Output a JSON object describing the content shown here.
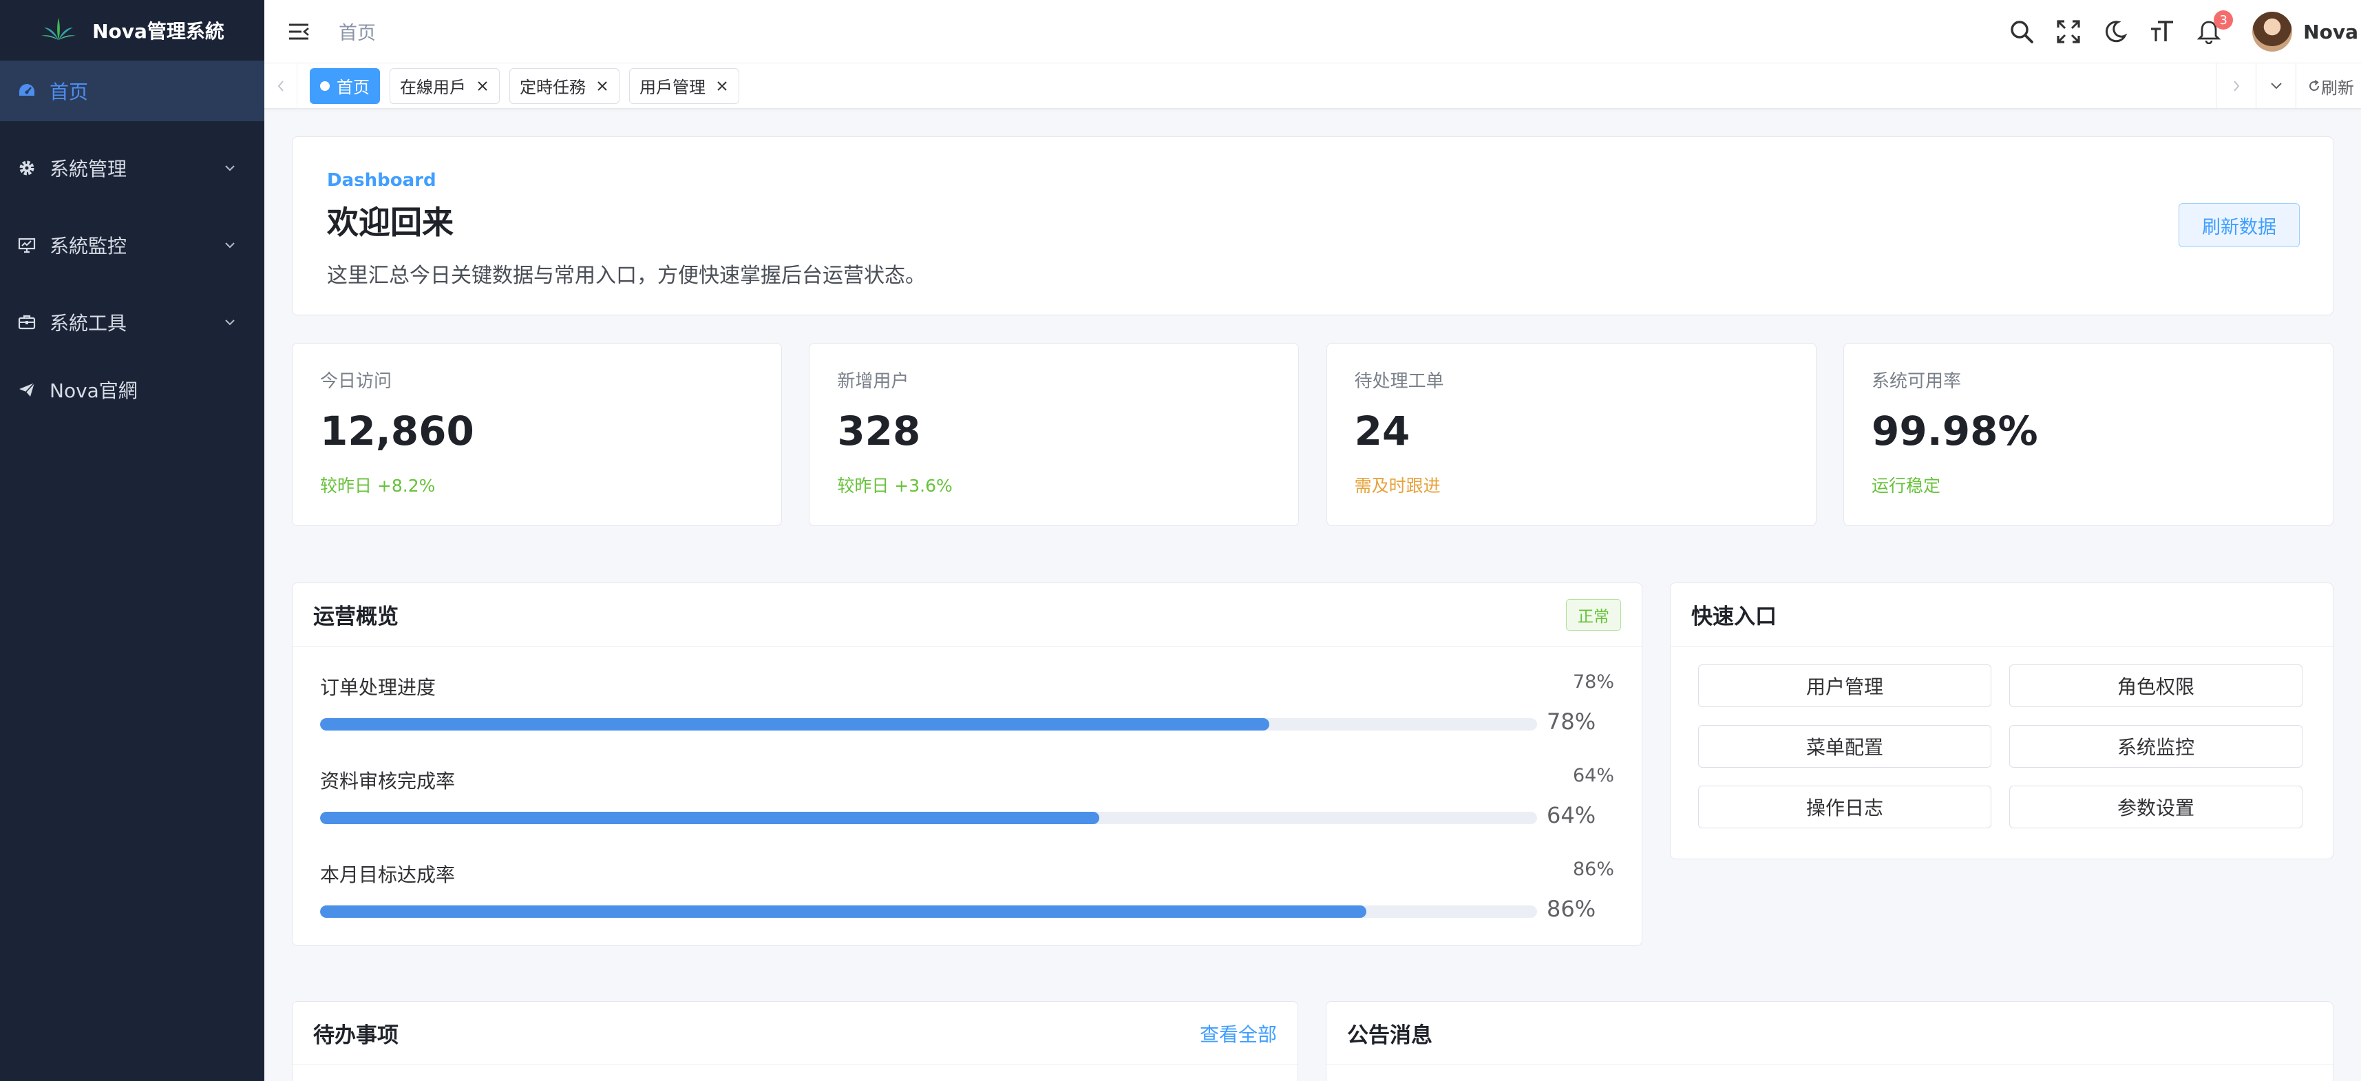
{
  "app": {
    "title": "Nova管理系統"
  },
  "sidebar": {
    "items": [
      {
        "label": "首页"
      },
      {
        "label": "系統管理"
      },
      {
        "label": "系統監控"
      },
      {
        "label": "系統工具"
      },
      {
        "label": "Nova官網"
      }
    ]
  },
  "navbar": {
    "breadcrumb": "首页",
    "notification_count": "3",
    "user_name": "Nova"
  },
  "tags": {
    "items": [
      "首页",
      "在線用戶",
      "定時任務",
      "用戶管理"
    ],
    "refresh_label": "刷新"
  },
  "welcome": {
    "kicker": "Dashboard",
    "title": "欢迎回来",
    "description": "这里汇总今日关键数据与常用入口，方便快速掌握后台运营状态。",
    "refresh_button": "刷新数据"
  },
  "stats": [
    {
      "label": "今日访问",
      "value": "12,860",
      "note": "较昨日 +8.2%",
      "note_color": "#67c23a"
    },
    {
      "label": "新增用户",
      "value": "328",
      "note": "较昨日 +3.6%",
      "note_color": "#67c23a"
    },
    {
      "label": "待处理工单",
      "value": "24",
      "note": "需及时跟进",
      "note_color": "#e6a23c"
    },
    {
      "label": "系统可用率",
      "value": "99.98%",
      "note": "运行稳定",
      "note_color": "#67c23a"
    }
  ],
  "operations": {
    "title": "运营概览",
    "status": "正常",
    "items": [
      {
        "label": "订单处理进度",
        "percent": 78,
        "text": "78%"
      },
      {
        "label": "资料审核完成率",
        "percent": 64,
        "text": "64%"
      },
      {
        "label": "本月目标达成率",
        "percent": 86,
        "text": "86%"
      }
    ]
  },
  "quick": {
    "title": "快速入口",
    "items": [
      "用户管理",
      "角色权限",
      "菜单配置",
      "系统监控",
      "操作日志",
      "参数设置"
    ]
  },
  "todo": {
    "title": "待办事项",
    "view_all": "查看全部"
  },
  "notice": {
    "title": "公告消息"
  },
  "colors": {
    "primary": "#409eff",
    "sidebar_bg": "#1b2437",
    "success": "#67c23a",
    "warning": "#e6a23c"
  }
}
